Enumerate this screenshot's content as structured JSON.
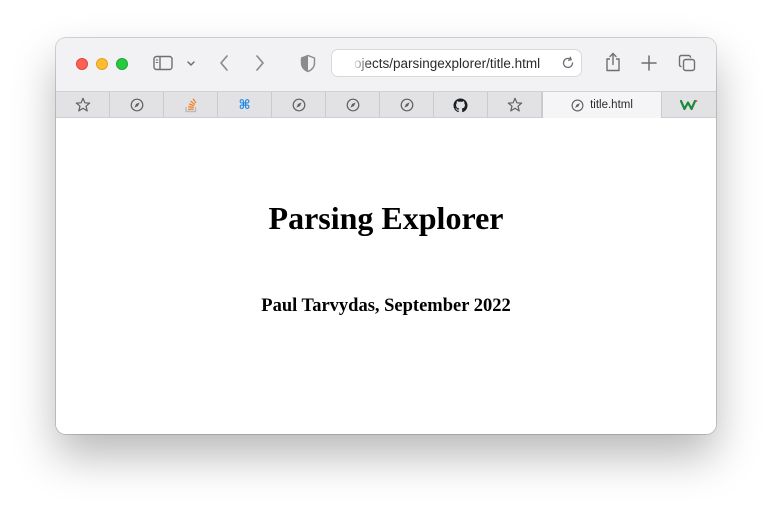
{
  "browser": {
    "address_bar": {
      "url_text": "ojects/parsingexplorer/title.html"
    },
    "tabs": [
      {
        "type": "pinned",
        "icon": "star-icon"
      },
      {
        "type": "pinned",
        "icon": "compass-icon"
      },
      {
        "type": "pinned",
        "icon": "stackoverflow-icon"
      },
      {
        "type": "pinned",
        "icon": "command-icon"
      },
      {
        "type": "pinned",
        "icon": "compass-icon"
      },
      {
        "type": "pinned",
        "icon": "compass-icon"
      },
      {
        "type": "pinned",
        "icon": "compass-icon"
      },
      {
        "type": "pinned",
        "icon": "github-icon"
      },
      {
        "type": "pinned",
        "icon": "star-icon"
      },
      {
        "type": "active",
        "icon": "compass-icon",
        "label": "title.html"
      },
      {
        "type": "pinned",
        "icon": "webflow-icon"
      }
    ],
    "colors": {
      "close": "#ff5f57",
      "minimize": "#febc2e",
      "zoom": "#28c840",
      "stackoverflow": "#f48024",
      "command": "#1e88e5",
      "webflow": "#1a8a3a"
    }
  },
  "page": {
    "title": "Parsing Explorer",
    "author_line": "Paul Tarvydas, September 2022"
  }
}
